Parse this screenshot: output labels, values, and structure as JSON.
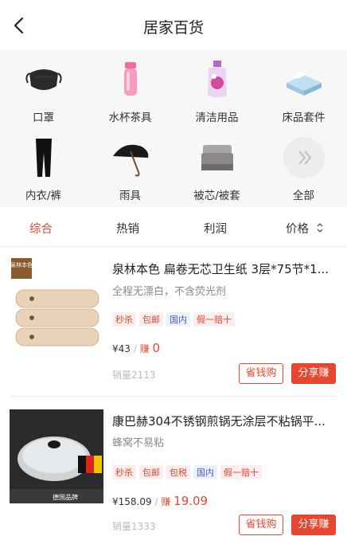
{
  "header": {
    "title": "居家百货"
  },
  "categories": [
    {
      "label": "口罩",
      "icon": "mask-icon"
    },
    {
      "label": "水杯茶具",
      "icon": "thermos-icon"
    },
    {
      "label": "清洁用品",
      "icon": "detergent-bottle-icon"
    },
    {
      "label": "床品套件",
      "icon": "bedding-icon"
    },
    {
      "label": "内衣/裤",
      "icon": "leggings-icon"
    },
    {
      "label": "雨具",
      "icon": "umbrella-icon"
    },
    {
      "label": "被芯/被套",
      "icon": "duvet-icon"
    },
    {
      "label": "全部",
      "icon": "double-chevron-right-icon"
    }
  ],
  "sort": {
    "items": [
      "综合",
      "热销",
      "利润",
      "价格"
    ],
    "active": "综合",
    "accent": "#e8462f"
  },
  "products": [
    {
      "title": "泉林本色 扁卷无芯卫生纸 3层*75节*1...",
      "subtitle": "全程无漂白，不含荧光剂",
      "tags": [
        "秒杀",
        "包邮",
        "国内",
        "假一赔十"
      ],
      "price": "¥43",
      "earn_label": "赚",
      "earn": "0",
      "sales": "销量2113",
      "save_btn": "省钱购",
      "share_btn": "分享赚",
      "brand_text": "泉林本色"
    },
    {
      "title": "康巴赫304不锈钢煎锅无涂层不粘锅平...",
      "subtitle": "蜂窝不易粘",
      "tags": [
        "秒杀",
        "包邮",
        "包税",
        "国内",
        "假一赔十"
      ],
      "price": "¥158.09",
      "earn_label": "赚",
      "earn": "19.09",
      "sales": "销量1333",
      "save_btn": "省钱购",
      "share_btn": "分享赚",
      "brand_text": "德国品牌"
    }
  ]
}
